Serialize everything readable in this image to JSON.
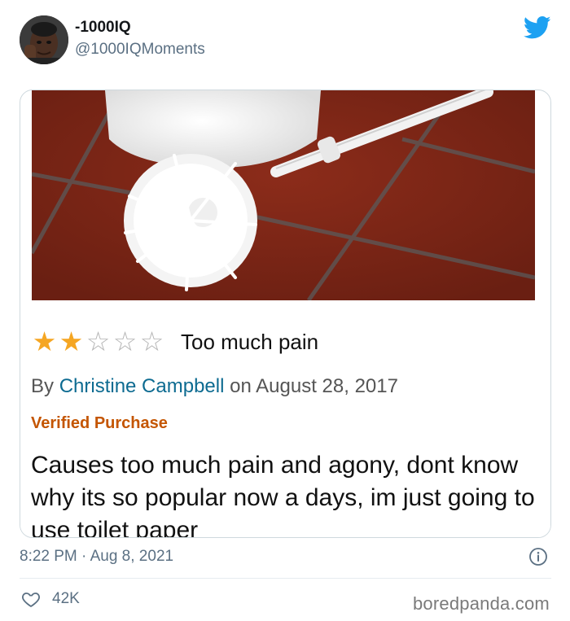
{
  "tweet": {
    "display_name": "-1000IQ",
    "handle": "@1000IQMoments",
    "timestamp": "8:22 PM · Aug 8, 2021",
    "likes": "42K"
  },
  "review": {
    "rating": 2,
    "max_rating": 5,
    "title": "Too much pain",
    "by_prefix": "By ",
    "author": "Christine Campbell",
    "date_text": " on August 28, 2017",
    "verified": "Verified Purchase",
    "body": "Causes too much pain and agony, dont know why its so popular now a days, im just going to use toilet paper"
  },
  "watermark": "boredpanda.com",
  "icons": {
    "brand": "twitter-bird-icon",
    "info": "info-icon",
    "like": "heart-icon"
  },
  "colors": {
    "twitter_blue": "#1da1f2",
    "star": "#f5a623",
    "author_link": "#0d6b91",
    "verified": "#c45500",
    "muted": "#5b7083"
  }
}
